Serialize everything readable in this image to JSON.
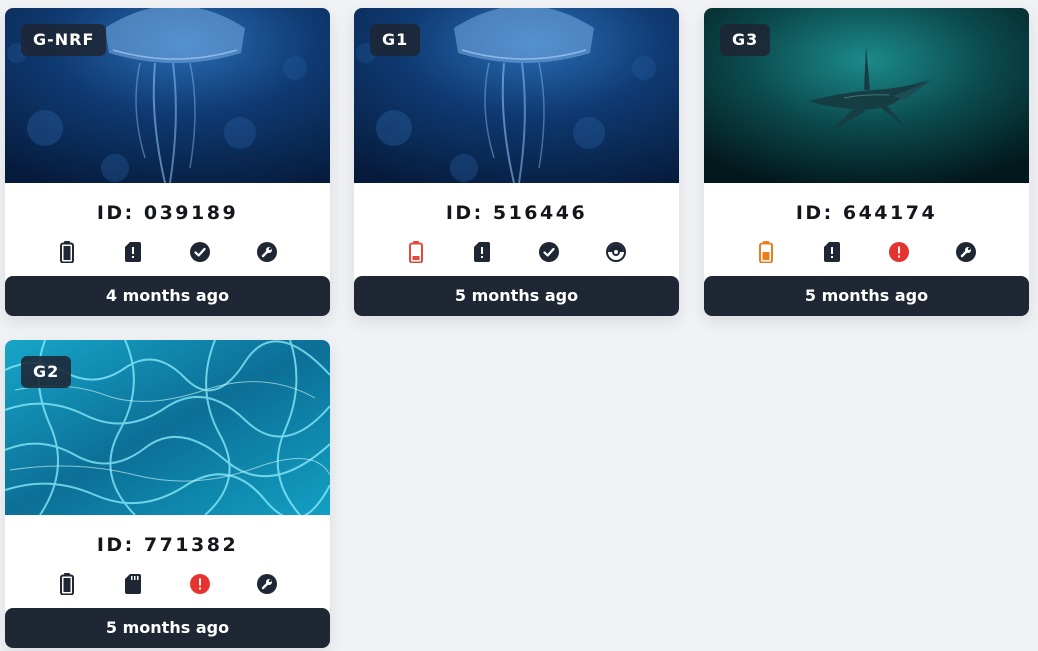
{
  "devices": [
    {
      "name": "G-NRF",
      "id_text": "ID: 039189",
      "last_seen": "4 months ago",
      "image": "jellyfish",
      "status_icons": [
        {
          "icon": "battery-full-icon",
          "color": "#1f2634"
        },
        {
          "icon": "sd-card-alert-icon",
          "color": "#1f2634"
        },
        {
          "icon": "check-circle-icon",
          "color": "#1f2634"
        },
        {
          "icon": "wrench-circle-icon",
          "color": "#1f2634"
        }
      ]
    },
    {
      "name": "G1",
      "id_text": "ID: 516446",
      "last_seen": "5 months ago",
      "image": "jellyfish",
      "status_icons": [
        {
          "icon": "battery-low-icon",
          "color": "#e5483d"
        },
        {
          "icon": "sd-card-alert-icon",
          "color": "#1f2634"
        },
        {
          "icon": "check-circle-icon",
          "color": "#1f2634"
        },
        {
          "icon": "disc-icon",
          "color": "#1f2634"
        }
      ]
    },
    {
      "name": "G3",
      "id_text": "ID: 644174",
      "last_seen": "5 months ago",
      "image": "shark",
      "status_icons": [
        {
          "icon": "battery-medium-icon",
          "color": "#ea7d1c"
        },
        {
          "icon": "sd-card-alert-icon",
          "color": "#1f2634"
        },
        {
          "icon": "error-circle-icon",
          "color": "#e5342f"
        },
        {
          "icon": "wrench-circle-icon",
          "color": "#1f2634"
        }
      ]
    },
    {
      "name": "G2",
      "id_text": "ID: 771382",
      "last_seen": "5 months ago",
      "image": "water",
      "status_icons": [
        {
          "icon": "battery-full-icon",
          "color": "#1f2634"
        },
        {
          "icon": "sd-card-icon",
          "color": "#1f2634"
        },
        {
          "icon": "error-circle-icon",
          "color": "#e5342f"
        },
        {
          "icon": "wrench-circle-icon",
          "color": "#1f2634"
        }
      ]
    }
  ]
}
